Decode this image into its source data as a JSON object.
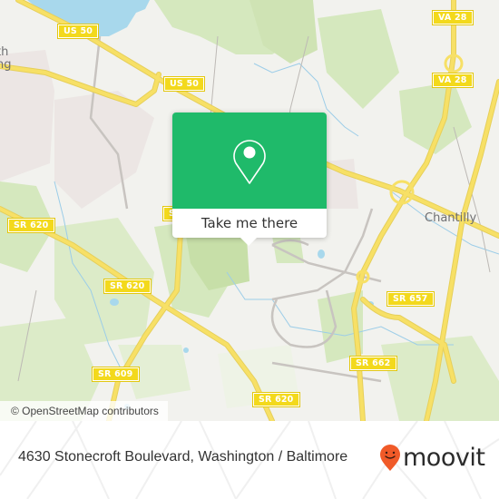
{
  "map": {
    "road_shields": [
      {
        "label": "US 50"
      },
      {
        "label": "US 50"
      },
      {
        "label": "VA 28"
      },
      {
        "label": "VA 28"
      },
      {
        "label": "SR 620"
      },
      {
        "label": "SR 620"
      },
      {
        "label": "SR 620"
      },
      {
        "label": "SR 609"
      },
      {
        "label": "SR 657"
      },
      {
        "label": "SR 662"
      },
      {
        "label": "SR 620"
      }
    ],
    "places": [
      {
        "label": "th"
      },
      {
        "label": "ng"
      },
      {
        "label": "Chantilly"
      }
    ],
    "attribution": "© OpenStreetMap contributors"
  },
  "popup": {
    "action_label": "Take me there",
    "icon": "map-pin-icon",
    "accent_color": "#1fba6a"
  },
  "footer": {
    "address": "4630 Stonecroft Boulevard, Washington / Baltimore",
    "brand": "moovit",
    "brand_icon": "moovit-pin-icon",
    "brand_color": "#f05a28"
  }
}
